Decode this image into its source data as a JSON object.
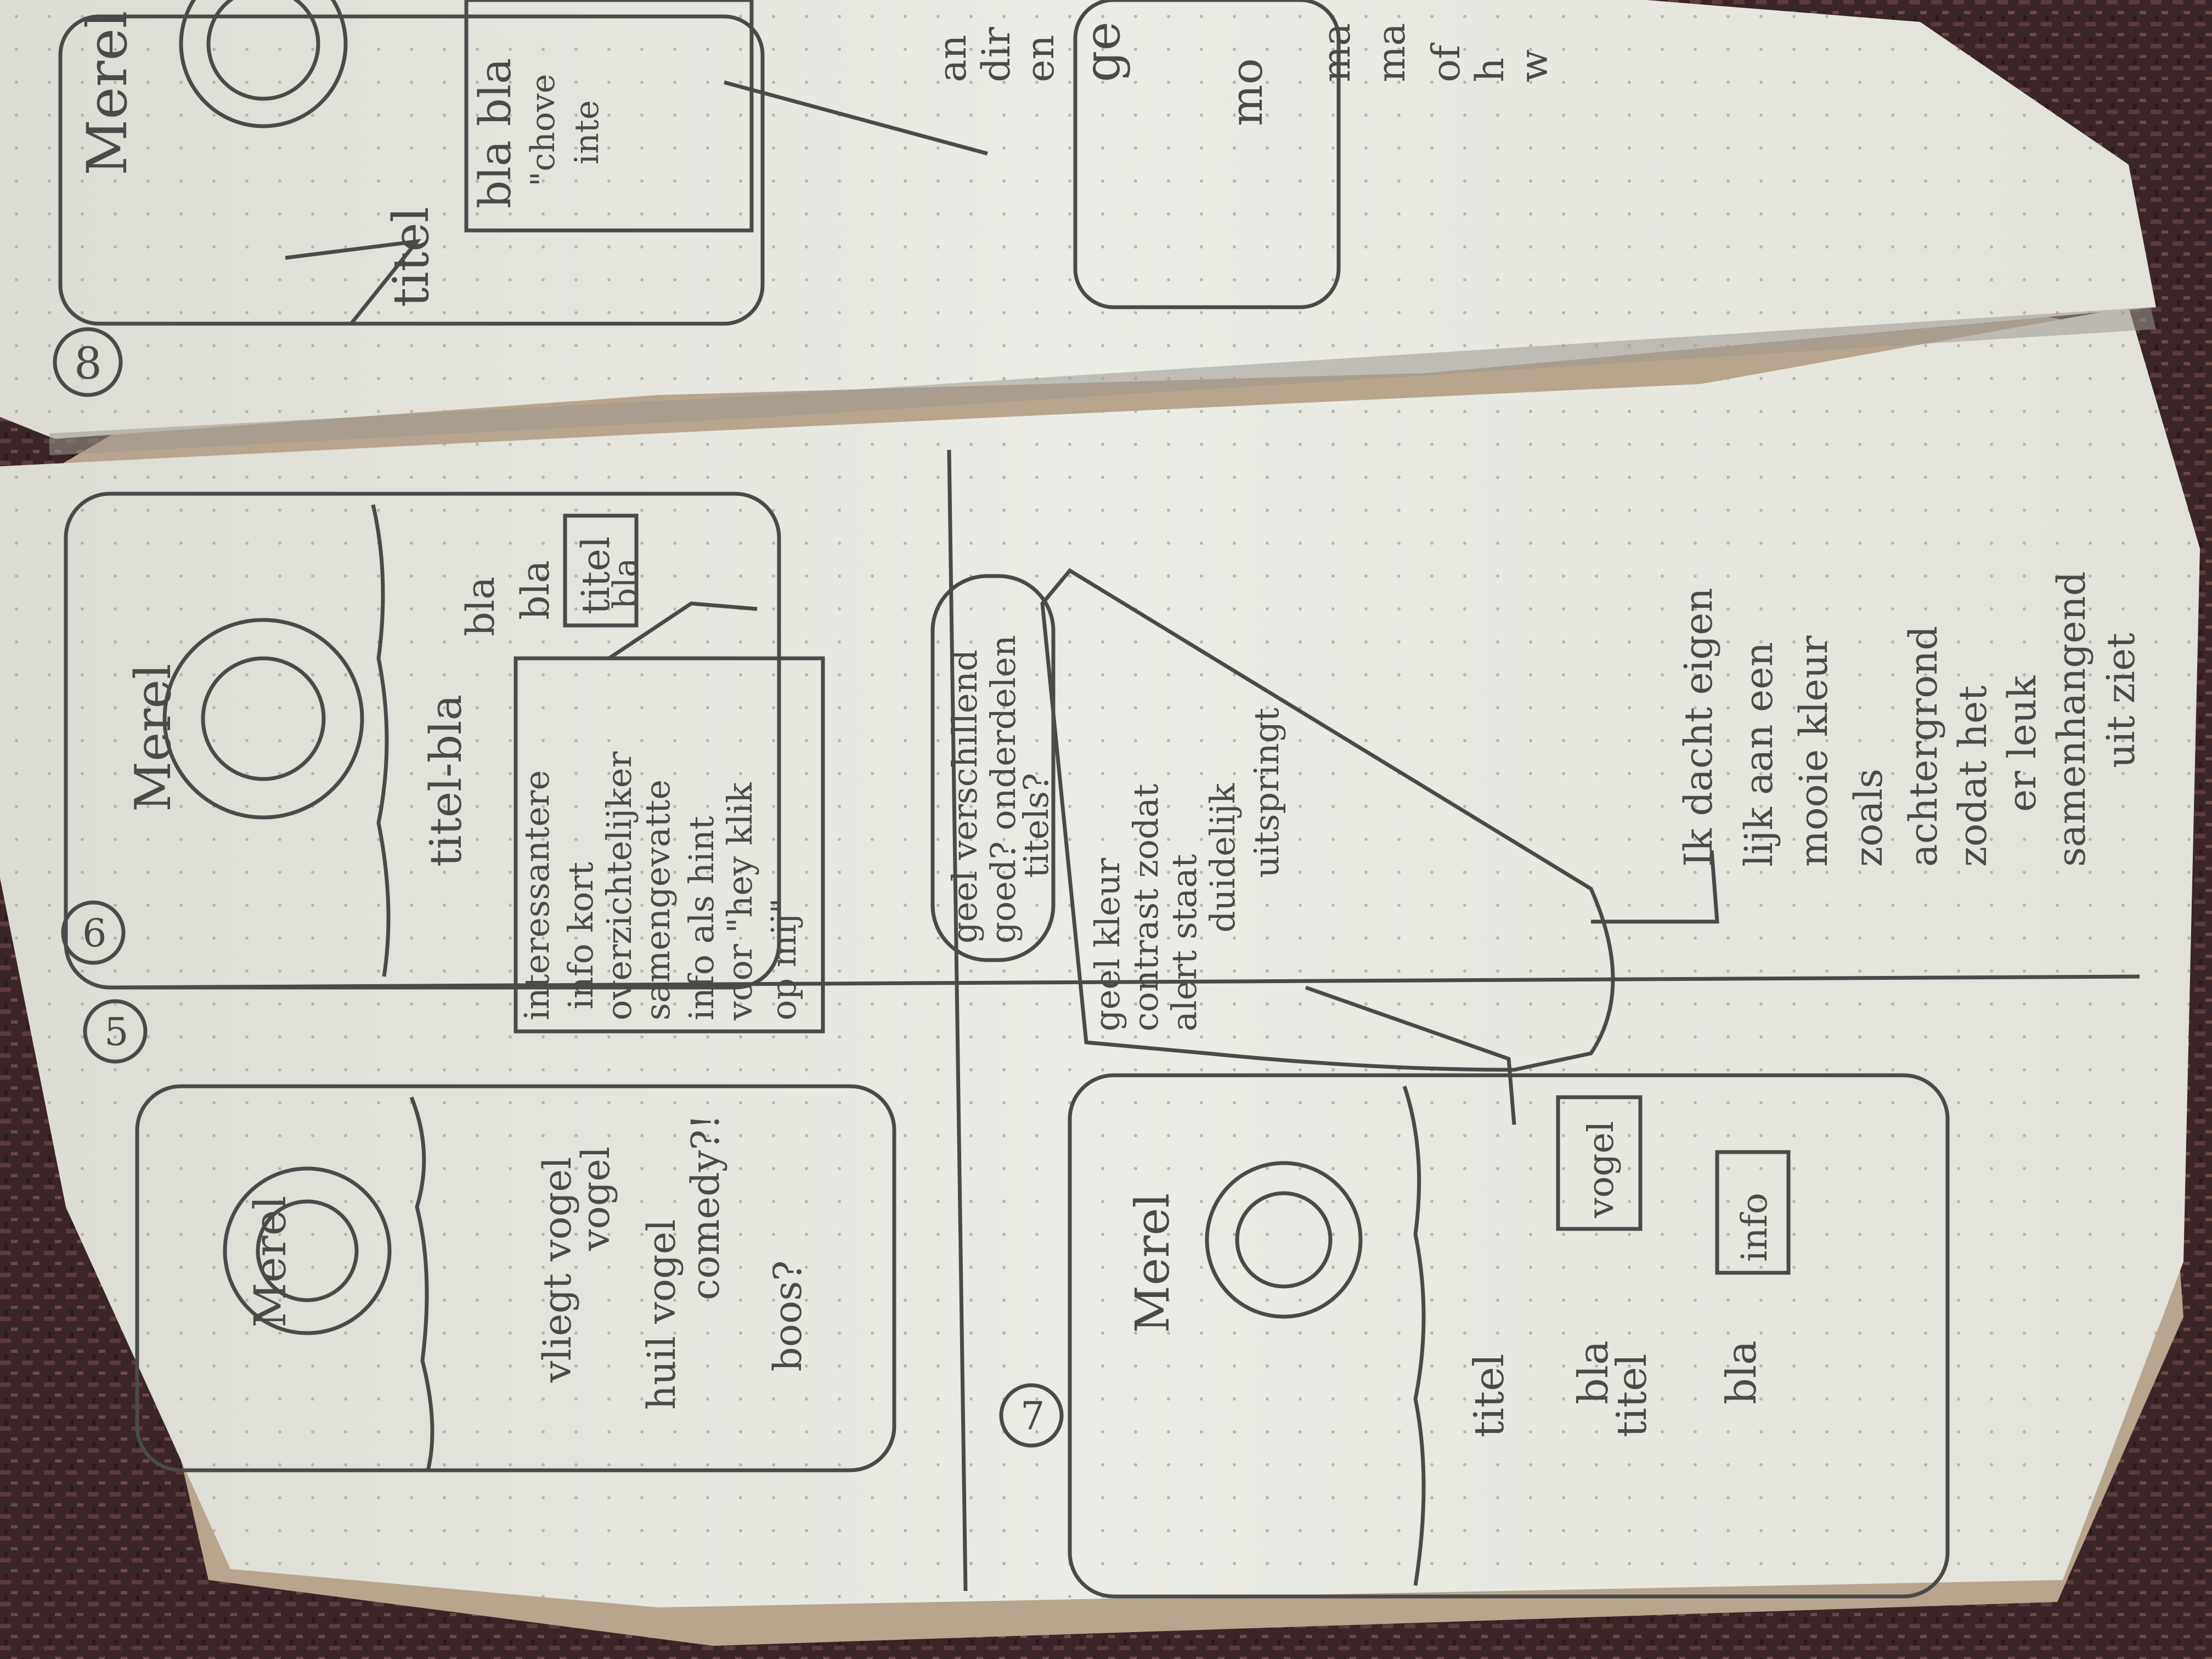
{
  "colors": {
    "background_fabric": "#3a2528",
    "fabric_accent": "#5c3a3e",
    "paper": "#ecece6",
    "paper_shadow": "#c9c9c2",
    "pencil": "#4a4a4a",
    "book_edge": "#b8a58e"
  },
  "top_page": {
    "sketch_number": "8",
    "card_name": "Merel",
    "label_titel": "titel",
    "label_bla": "bla bla",
    "note_fragment_1": "\"chove",
    "note_fragment_2": "inte",
    "side_text_1": "an",
    "side_text_2": "dir",
    "side_text_3": "en",
    "side_text_4": "ge",
    "side_text_5": "mo",
    "side_text_6": "ma",
    "side_text_7": "ma",
    "side_text_8": "of",
    "side_text_9": "h",
    "side_text_10": "w"
  },
  "bottom_page": {
    "sketch_5": {
      "number": "5",
      "card_name": "Merel",
      "line_1": "vliegt vogel",
      "line_2": "vogel",
      "line_3": "huil vogel",
      "line_4": "comedy?!",
      "line_5": "boos?"
    },
    "sketch_6": {
      "number": "6",
      "card_name": "Merel",
      "line_1": "titel-bla",
      "line_2": "bla",
      "line_3": "bla",
      "label_titel": "titel",
      "label_bla": "bla"
    },
    "note_6": {
      "line_1": "interessantere",
      "line_2": "info kort",
      "line_3": "overzichtelijker",
      "line_4": "samengevatte",
      "line_5": "info als hint",
      "line_6": "voor \"hey klik",
      "line_7": "op mij\""
    },
    "note_middle": {
      "line_1": "geel verschillend",
      "line_2": "goed? onderdelen",
      "line_3": "titels?"
    },
    "note_triangle": {
      "line_1": "geel kleur",
      "line_2": "contrast zodat",
      "line_3": "alert staat",
      "line_4": "duidelijk",
      "line_5": "uitspringt"
    },
    "sketch_7": {
      "number": "7",
      "card_name": "Merel",
      "label_titel_1": "titel",
      "label_bla_1": "bla",
      "tag_1": "vogel",
      "label_titel_2": "titel",
      "label_bla_2": "bla",
      "tag_2": "info"
    },
    "note_right": {
      "line_1": "Ik dacht eigen",
      "line_2": "lijk aan een",
      "line_3": "mooie kleur",
      "line_4": "zoals",
      "line_5": "achtergrond",
      "line_6": "zodat het",
      "line_7": "er leuk",
      "line_8": "samenhangend",
      "line_9": "uit ziet"
    }
  }
}
